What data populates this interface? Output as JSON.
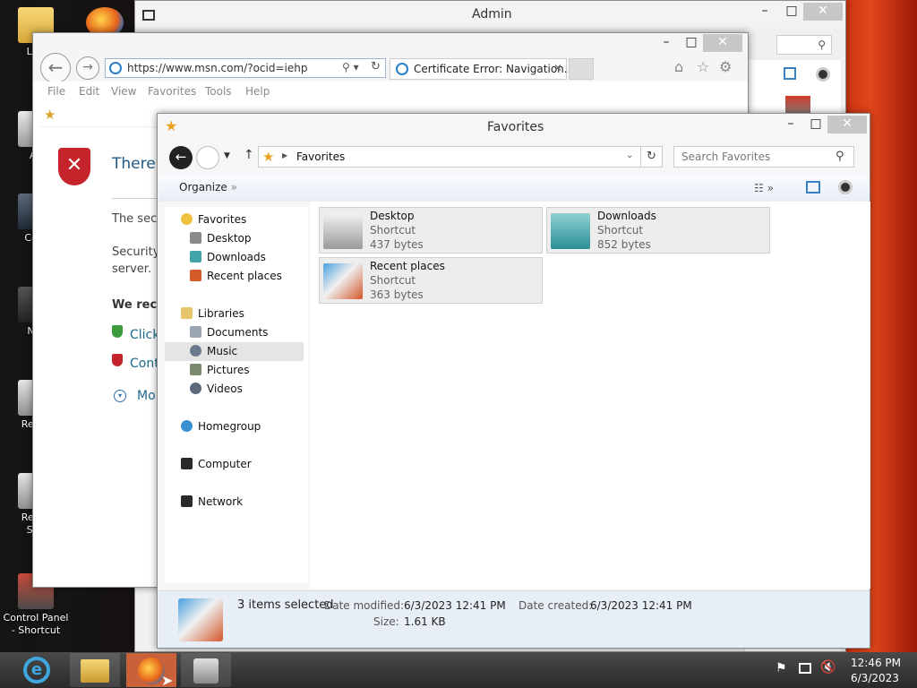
{
  "desktop": {
    "icons": [
      {
        "label": "Libr"
      },
      {
        "label": "Ad"
      },
      {
        "label": "Com"
      },
      {
        "label": "Net"
      },
      {
        "label": "Recyc"
      },
      {
        "label": "Recyc Sho"
      },
      {
        "label": "Control Panel - Shortcut"
      }
    ]
  },
  "admin_window": {
    "title": "Admin",
    "search_icon": "search-icon"
  },
  "ie_window": {
    "url": "https://www.msn.com/?ocid=iehp",
    "tab_label": "Certificate Error: Navigation...",
    "menu": [
      "File",
      "Edit",
      "View",
      "Favorites",
      "Tools",
      "Help"
    ],
    "error_heading": "There",
    "line1": "The secu",
    "line2a": "Security",
    "line2b": "server.",
    "recommend": "We reco",
    "link1": "Click",
    "link2": "Cont",
    "more": "Mo"
  },
  "favorites_window": {
    "title": "Favorites",
    "breadcrumb": "Favorites",
    "search_placeholder": "Search Favorites",
    "organize": "Organize",
    "tree": {
      "favorites": "Favorites",
      "desktop": "Desktop",
      "downloads": "Downloads",
      "recent": "Recent places",
      "libraries": "Libraries",
      "documents": "Documents",
      "music": "Music",
      "pictures": "Pictures",
      "videos": "Videos",
      "homegroup": "Homegroup",
      "computer": "Computer",
      "network": "Network"
    },
    "items": [
      {
        "name": "Desktop",
        "type": "Shortcut",
        "size": "437 bytes"
      },
      {
        "name": "Downloads",
        "type": "Shortcut",
        "size": "852 bytes"
      },
      {
        "name": "Recent places",
        "type": "Shortcut",
        "size": "363 bytes"
      }
    ],
    "details": {
      "selected": "3 items selected",
      "date_modified_label": "Date modified:",
      "date_modified": "6/3/2023 12:41 PM",
      "date_created_label": "Date created:",
      "date_created": "6/3/2023 12:41 PM",
      "size_label": "Size:",
      "size": "1.61 KB"
    }
  },
  "taskbar": {
    "time": "12:46 PM",
    "date": "6/3/2023"
  },
  "colors": {
    "selected_tree": "#e5e5e5",
    "details_bg": "#e8eef6",
    "link": "#1e6a8a"
  }
}
